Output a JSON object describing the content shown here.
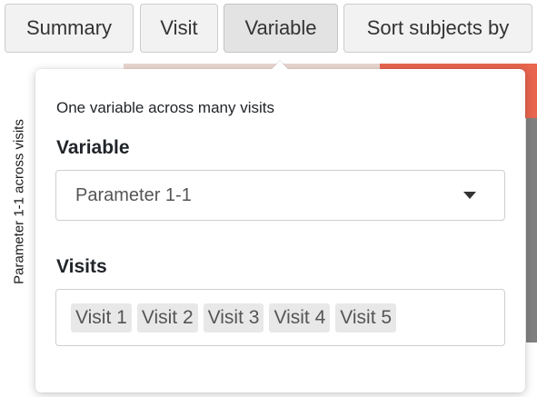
{
  "toolbar": {
    "buttons": [
      {
        "id": "summary",
        "label": "Summary"
      },
      {
        "id": "visit",
        "label": "Visit"
      },
      {
        "id": "variable",
        "label": "Variable"
      },
      {
        "id": "sort",
        "label": "Sort subjects by"
      }
    ]
  },
  "plot": {
    "y_axis_label": "Parameter 1-1 across visits",
    "colors": {
      "band_light": "#ead7d0",
      "band_accent": "#e8654e",
      "column": "#808080"
    }
  },
  "popover": {
    "description": "One variable across many visits",
    "variable": {
      "label": "Variable",
      "selected": "Parameter 1-1"
    },
    "visits": {
      "label": "Visits",
      "selected": [
        "Visit 1",
        "Visit 2",
        "Visit 3",
        "Visit 4",
        "Visit 5"
      ]
    }
  }
}
